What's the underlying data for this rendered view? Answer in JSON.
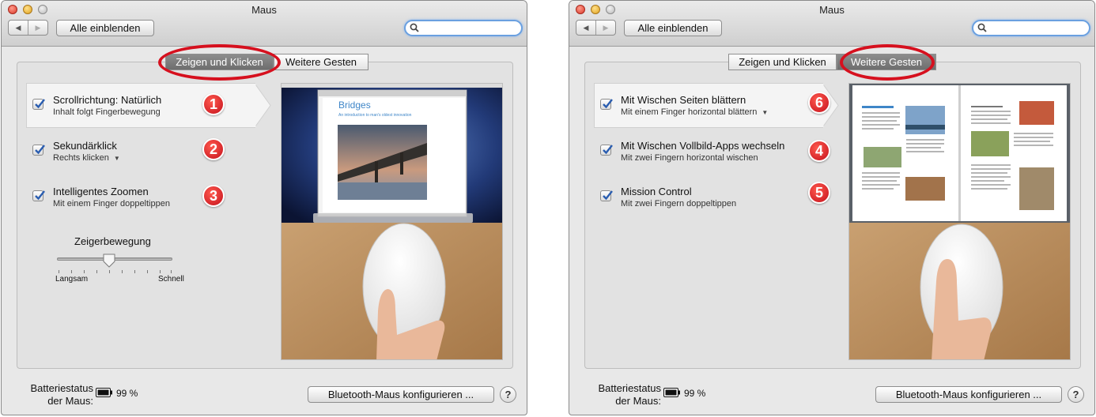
{
  "colors": {
    "accent": "#d6101e",
    "checkbox_check": "#2a5db0",
    "search_focus": "#6aa0e0"
  },
  "left_window": {
    "title": "Maus",
    "show_all": "Alle einblenden",
    "search": {
      "placeholder": "",
      "icon": "search-icon"
    },
    "tabs": [
      {
        "label": "Zeigen und Klicken",
        "selected": true
      },
      {
        "label": "Weitere Gesten",
        "selected": false
      }
    ],
    "options": [
      {
        "title": "Scrollrichtung: Natürlich",
        "subtitle": "Inhalt folgt Fingerbewegung",
        "checked": true,
        "badge": "1"
      },
      {
        "title": "Sekundärklick",
        "subtitle": "Rechts klicken",
        "checked": true,
        "badge": "2"
      },
      {
        "title": "Intelligentes Zoomen",
        "subtitle": "Mit einem Finger doppeltippen",
        "checked": true,
        "badge": "3"
      }
    ],
    "slider": {
      "label": "Zeigerbewegung",
      "min_label": "Langsam",
      "max_label": "Schnell",
      "value": 0.45
    },
    "preview": {
      "doc_title": "Bridges",
      "doc_subtitle": "An introduction to man's oldest innovation"
    },
    "battery": {
      "label": "Batteriestatus der Maus:",
      "value": "99 %"
    },
    "bt_button": "Bluetooth-Maus konfigurieren ...",
    "help": "?"
  },
  "right_window": {
    "title": "Maus",
    "show_all": "Alle einblenden",
    "search": {
      "placeholder": "",
      "icon": "search-icon"
    },
    "tabs": [
      {
        "label": "Zeigen und Klicken",
        "selected": false
      },
      {
        "label": "Weitere Gesten",
        "selected": true
      }
    ],
    "options": [
      {
        "title": "Mit Wischen Seiten blättern",
        "subtitle": "Mit einem Finger horizontal blättern",
        "checked": true,
        "badge": "6"
      },
      {
        "title": "Mit Wischen Vollbild-Apps wechseln",
        "subtitle": "Mit zwei Fingern horizontal wischen",
        "checked": true,
        "badge": "4"
      },
      {
        "title": "Mission Control",
        "subtitle": "Mit zwei Fingern doppeltippen",
        "checked": true,
        "badge": "5"
      }
    ],
    "battery": {
      "label": "Batteriestatus der Maus:",
      "value": "99 %"
    },
    "bt_button": "Bluetooth-Maus konfigurieren ...",
    "help": "?"
  }
}
